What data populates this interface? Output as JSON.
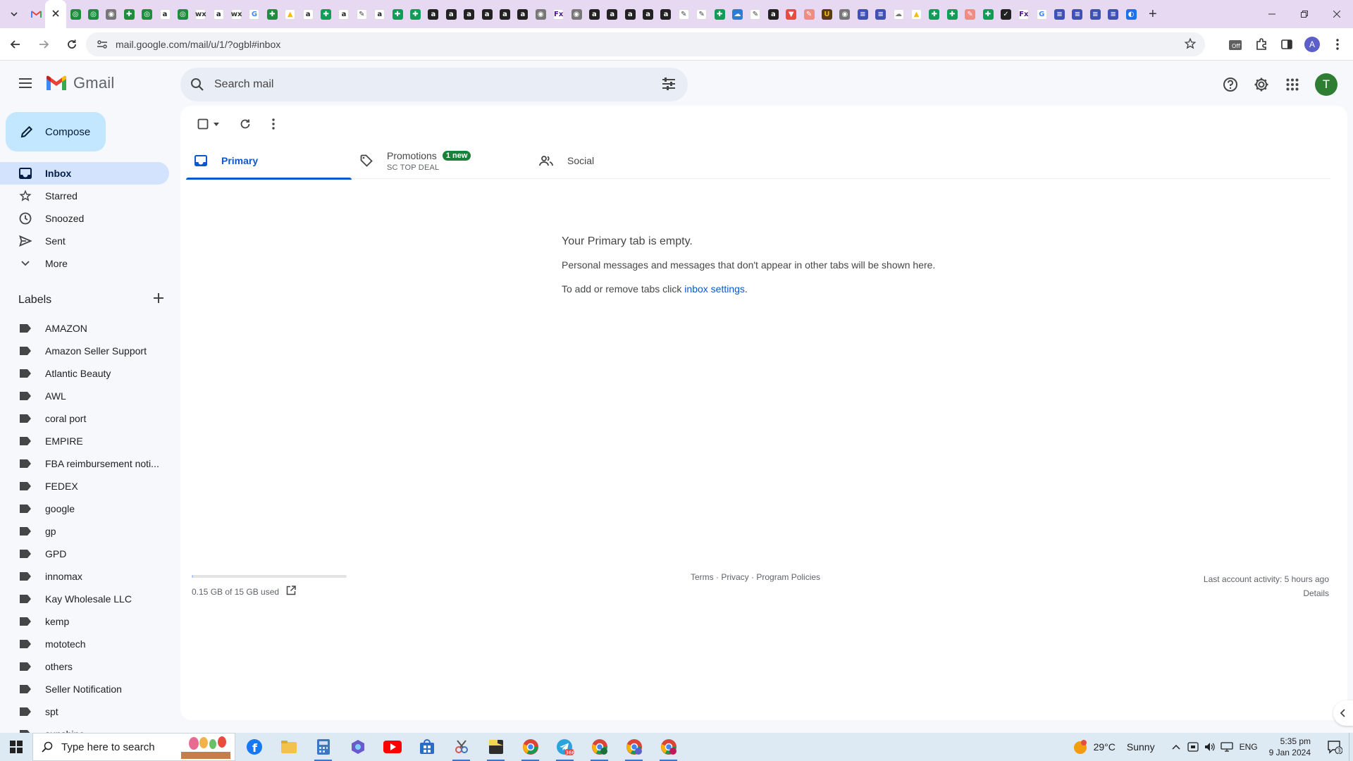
{
  "browser": {
    "tab_favicons": [
      "pin-green",
      "pin-green",
      "chrome",
      "puzzle",
      "pin-green",
      "amazon",
      "pin-green",
      "wix",
      "amazon",
      "wix",
      "google",
      "puzzle",
      "drive",
      "amazon",
      "sheets",
      "amazon",
      "pen",
      "amazon",
      "sheets",
      "sheets",
      "amazon-dark",
      "amazon-dark",
      "amazon-dark",
      "amazon-dark",
      "amazon-dark",
      "amazon-dark",
      "chrome",
      "fedex",
      "chrome",
      "amazon-dark",
      "amazon-dark",
      "amazon-dark",
      "amazon-dark",
      "amazon-dark",
      "pen",
      "pen",
      "sheets",
      "onedrive",
      "pen",
      "amazon-dark",
      "vivaldi",
      "tag",
      "ups",
      "circle",
      "doc",
      "doc",
      "cloud",
      "drive",
      "sheets",
      "sheets",
      "tag",
      "sheets",
      "shield",
      "fedex",
      "google",
      "doc",
      "doc",
      "doc",
      "doc",
      "edge"
    ],
    "url": "mail.google.com/mail/u/1/?ogbl#inbox",
    "profile_initial": "A"
  },
  "gmail": {
    "app_name": "Gmail",
    "search_placeholder": "Search mail",
    "avatar_initial": "T",
    "compose_label": "Compose",
    "nav": [
      {
        "label": "Inbox",
        "icon": "inbox-icon",
        "active": true
      },
      {
        "label": "Starred",
        "icon": "star-icon",
        "active": false
      },
      {
        "label": "Snoozed",
        "icon": "clock-icon",
        "active": false
      },
      {
        "label": "Sent",
        "icon": "send-icon",
        "active": false
      },
      {
        "label": "More",
        "icon": "chevron-down-icon",
        "active": false
      }
    ],
    "labels_title": "Labels",
    "labels": [
      "AMAZON",
      "Amazon Seller Support",
      "Atlantic Beauty",
      "AWL",
      "coral port",
      "EMPIRE",
      "FBA reimbursement noti...",
      "FEDEX",
      "google",
      "gp",
      "GPD",
      "innomax",
      "Kay Wholesale LLC",
      "kemp",
      "mototech",
      "others",
      "Seller Notification",
      "spt",
      "sunshine"
    ],
    "tabs": [
      {
        "label": "Primary",
        "active": true
      },
      {
        "label": "Promotions",
        "badge": "1 new",
        "subtitle": "SC TOP DEAL",
        "active": false
      },
      {
        "label": "Social",
        "active": false
      }
    ],
    "empty_state": {
      "title": "Your Primary tab is empty.",
      "line1": "Personal messages and messages that don't appear in other tabs will be shown here.",
      "line2_prefix": "To add or remove tabs click ",
      "line2_link": "inbox settings",
      "line2_suffix": "."
    },
    "storage": {
      "text": "0.15 GB of 15 GB used",
      "used_fraction": 0.01
    },
    "footer": {
      "terms": "Terms",
      "privacy": "Privacy",
      "policies": "Program Policies",
      "sep": " · "
    },
    "activity": {
      "text": "Last account activity: 5 hours ago",
      "details": "Details"
    }
  },
  "taskbar": {
    "search_placeholder": "Type here to search",
    "weather": {
      "temp": "29°C",
      "condition": "Sunny"
    },
    "language": "ENG",
    "time": "5:35 pm",
    "date": "9 Jan 2024",
    "notifications": "3",
    "badges": {
      "telegram": "366"
    }
  },
  "colors": {
    "accent": "#0b57d0",
    "compose_bg": "#c2e7ff",
    "active_nav": "#d3e3fd",
    "badge_green": "#188038",
    "tabstrip": "#e8d9f3"
  }
}
